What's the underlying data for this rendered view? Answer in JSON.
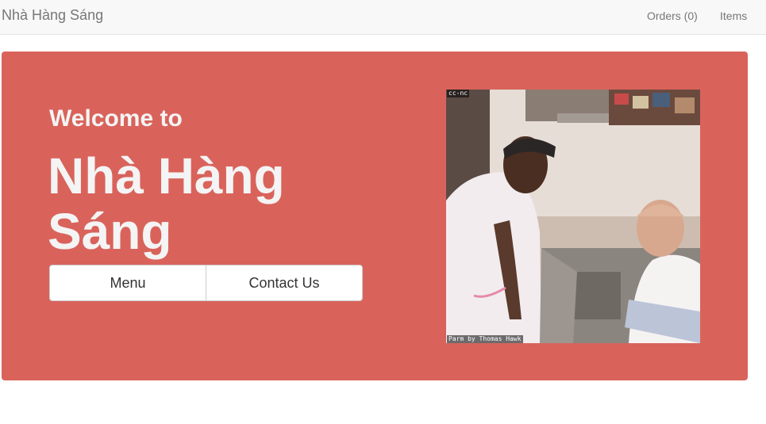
{
  "navbar": {
    "brand": "Nhà Hàng Sáng",
    "links": [
      {
        "label": "Orders (0)"
      },
      {
        "label": "Items"
      }
    ]
  },
  "hero": {
    "background_color": "#d9635b",
    "welcome": "Welcome to",
    "restaurant_name": "Nhà Hàng Sáng",
    "buttons": {
      "menu": "Menu",
      "contact": "Contact Us"
    },
    "photo": {
      "license_tag": "cc-nc",
      "caption": "Parm by Thomas Hawk"
    }
  }
}
